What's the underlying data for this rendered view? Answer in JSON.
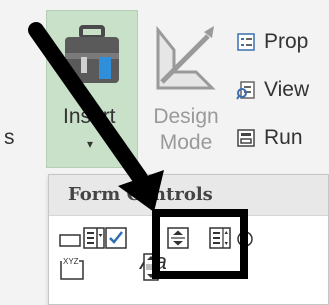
{
  "ribbon": {
    "edge_label": "s",
    "insert": {
      "label": "Insert",
      "caret": "▾"
    },
    "design_mode": {
      "line1": "Design",
      "line2": "Mode"
    },
    "commands": [
      {
        "label": "Prop",
        "icon": "properties-icon"
      },
      {
        "label": "View",
        "icon": "view-code-icon"
      },
      {
        "label": "Run",
        "icon": "run-dialog-icon"
      }
    ]
  },
  "form_controls": {
    "header": "Form Controls",
    "text_label": "Aa",
    "textfield_label": "XYZ",
    "controls": [
      "button-control-icon",
      "combo-box-icon",
      "check-box-icon",
      "spin-button-icon",
      "list-box-icon",
      "option-button-icon",
      "group-box-icon",
      "label-icon",
      "scroll-bar-icon"
    ]
  },
  "annotation": {
    "highlighted": "spin-button-icon"
  },
  "colors": {
    "insert_bg": "#c9e0c9",
    "highlight": "#000000",
    "arrow": "#000000"
  }
}
